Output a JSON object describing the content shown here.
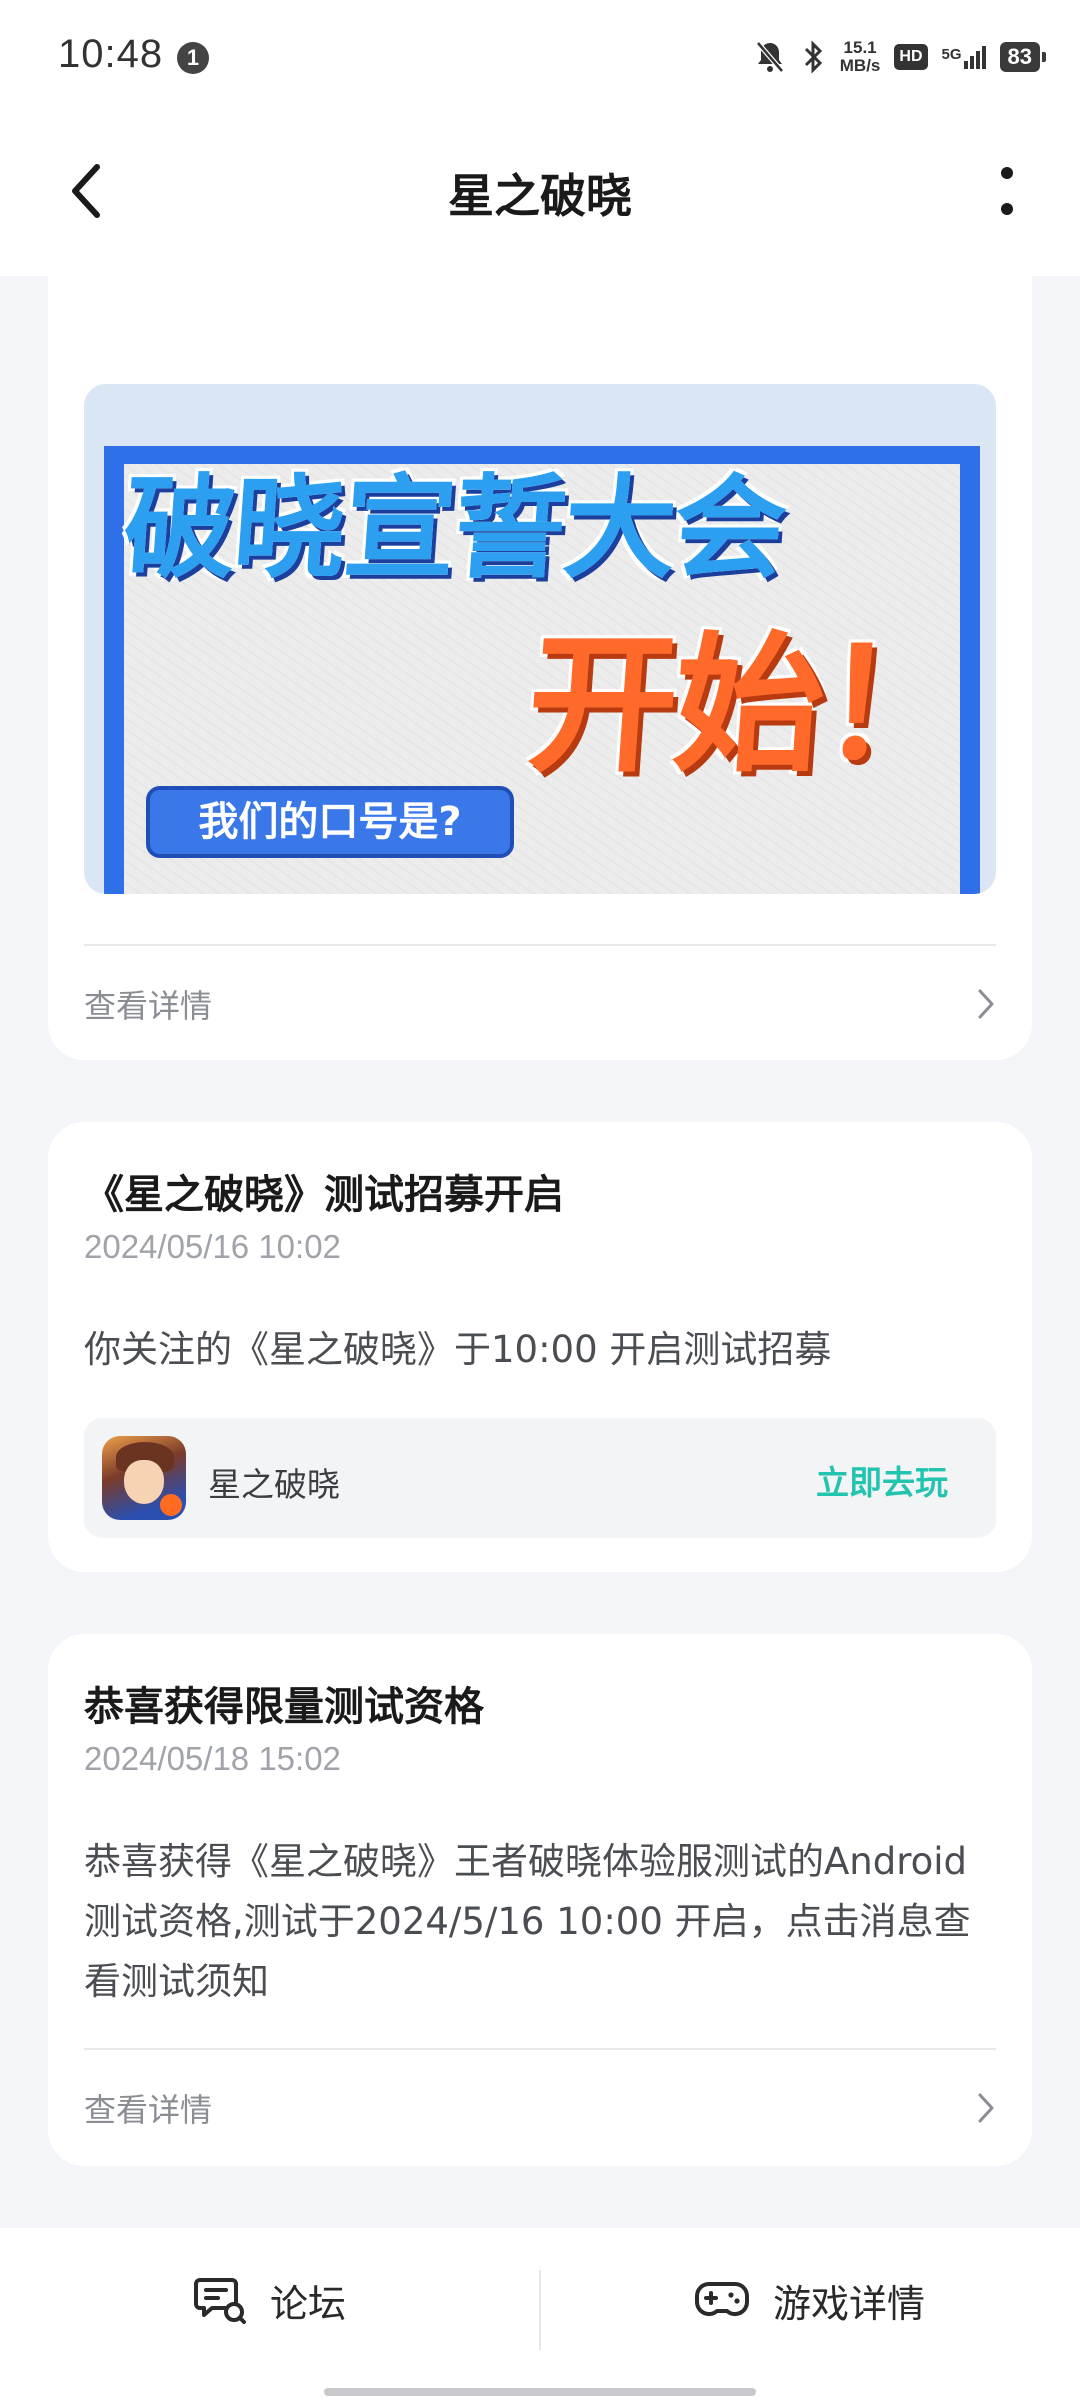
{
  "status_bar": {
    "time": "10:48",
    "notification_count": "1",
    "net_speed_value": "15.1",
    "net_speed_unit": "MB/s",
    "hd": "HD",
    "network": "5G",
    "battery": "83"
  },
  "header": {
    "title": "星之破晓"
  },
  "banner": {
    "headline": "破晓宣誓大会",
    "headline2": "开始！",
    "slogan": "我们的口号是?"
  },
  "card1": {
    "detail_label": "查看详情"
  },
  "card2": {
    "title": "《星之破晓》测试招募开启",
    "date": "2024/05/16 10:02",
    "body": "你关注的《星之破晓》于10:00 开启测试招募",
    "game_name": "星之破晓",
    "play_label": "立即去玩"
  },
  "card3": {
    "title": "恭喜获得限量测试资格",
    "date": "2024/05/18 15:02",
    "body": "恭喜获得《星之破晓》王者破晓体验服测试的Android测试资格,测试于2024/5/16 10:00 开启，点击消息查看测试须知",
    "detail_label": "查看详情"
  },
  "bottom_bar": {
    "forum_label": "论坛",
    "game_details_label": "游戏详情"
  },
  "colors": {
    "accent": "#22c4b0",
    "background": "#f3f5f8"
  },
  "icons": [
    "back-arrow-icon",
    "more-vertical-icon",
    "chevron-right-icon",
    "forum-chat-icon",
    "gamepad-icon",
    "mute-icon",
    "bluetooth-icon",
    "signal-icon",
    "battery-icon"
  ]
}
